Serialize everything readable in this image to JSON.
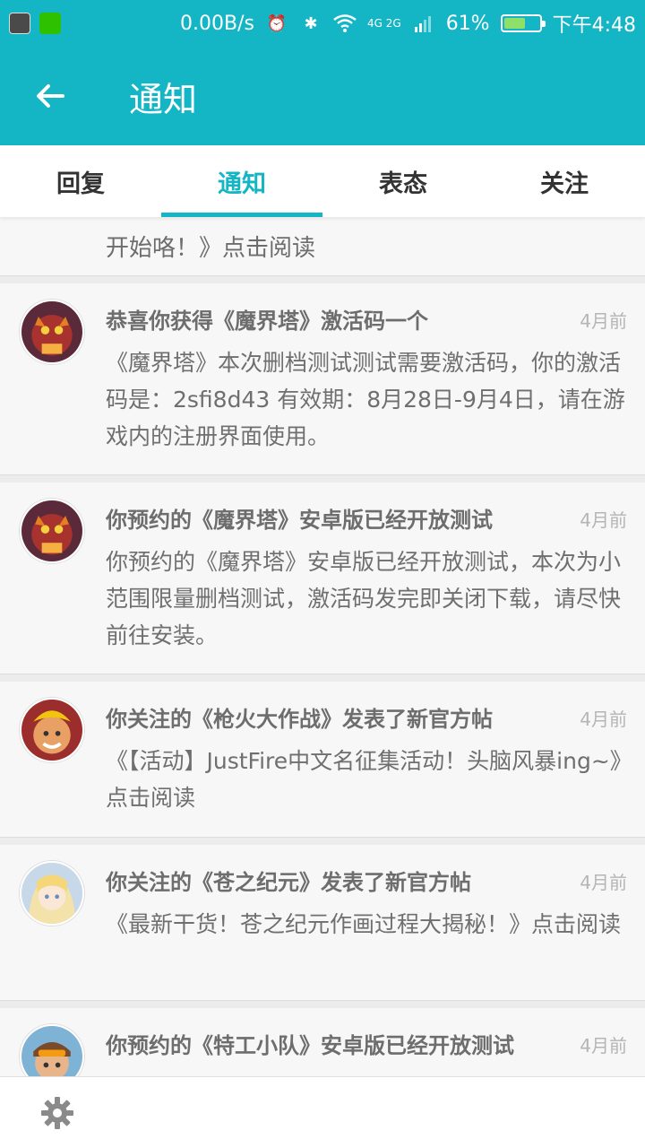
{
  "status_bar": {
    "speed": "0.00B/s",
    "battery": "61%",
    "time": "下午4:48",
    "network": "4G 2G",
    "battery_fill_percent": 61,
    "icons": [
      "shield-icon",
      "wechat-icon",
      "alarm-icon",
      "bluetooth-icon",
      "wifi-icon",
      "signal-icon"
    ]
  },
  "app_bar": {
    "title": "通知"
  },
  "tabs": [
    {
      "label": "回复"
    },
    {
      "label": "通知"
    },
    {
      "label": "表态"
    },
    {
      "label": "关注"
    }
  ],
  "notifications": {
    "partial_body": "开始咯！》点击阅读",
    "items": [
      {
        "title": "恭喜你获得《魔界塔》激活码一个",
        "time": "4月前",
        "body": "《魔界塔》本次删档测试测试需要激活码，你的激活码是：2sfi8d43 有效期：8月28日-9月4日，请在游戏内的注册界面使用。"
      },
      {
        "title": "你预约的《魔界塔》安卓版已经开放测试",
        "time": "4月前",
        "body": "你预约的《魔界塔》安卓版已经开放测试，本次为小范围限量删档测试，激活码发完即关闭下载，请尽快前往安装。"
      },
      {
        "title": "你关注的《枪火大作战》发表了新官方帖",
        "time": "4月前",
        "body": "《【活动】JustFire中文名征集活动！头脑风暴ing~》点击阅读"
      },
      {
        "title": "你关注的《苍之纪元》发表了新官方帖",
        "time": "4月前",
        "body": "《最新干货！苍之纪元作画过程大揭秘！》点击阅读"
      },
      {
        "title": "你预约的《特工小队》安卓版已经开放测试",
        "time": "4月前",
        "body": ""
      }
    ]
  },
  "bottom_bar": {
    "icon": "gear-icon"
  },
  "colors": {
    "accent": "#14b5c4",
    "battery_fill": "#8fe06b"
  }
}
